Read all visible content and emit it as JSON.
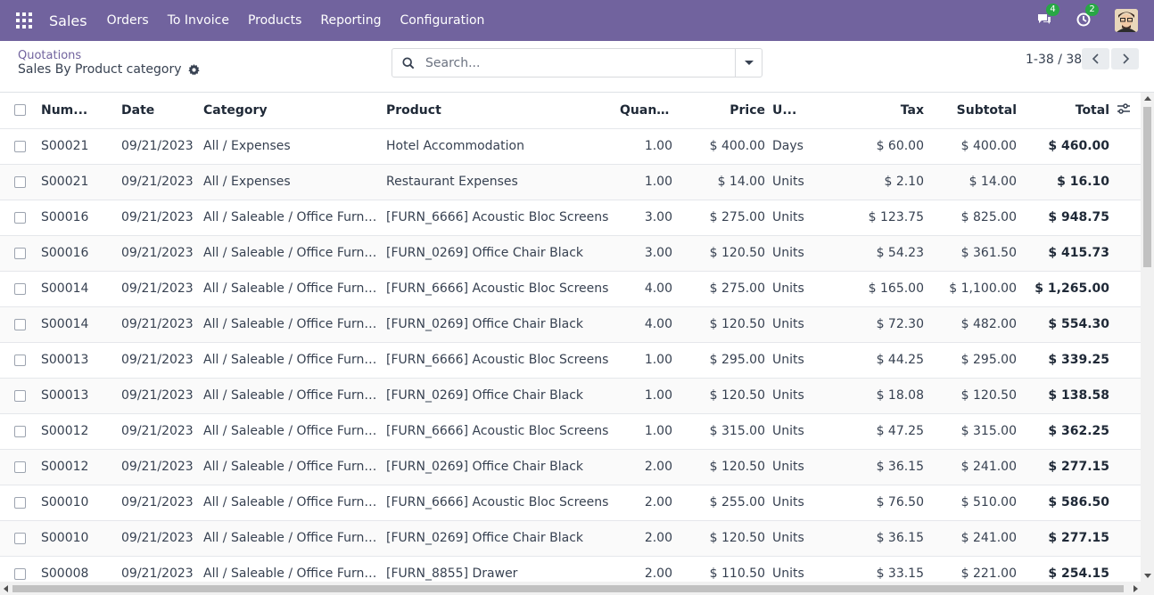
{
  "navbar": {
    "app_name": "Sales",
    "menu": [
      "Orders",
      "To Invoice",
      "Products",
      "Reporting",
      "Configuration"
    ],
    "messages_badge": "4",
    "activities_badge": "2"
  },
  "control_panel": {
    "breadcrumb": "Quotations",
    "title": "Sales By Product category",
    "search_placeholder": "Search...",
    "pager": "1-38 / 38"
  },
  "table": {
    "columns": [
      "Num...",
      "Date",
      "Category",
      "Product",
      "Quant...",
      "Price",
      "U...",
      "Tax",
      "Subtotal",
      "Total"
    ],
    "rows": [
      [
        "S00021",
        "09/21/2023",
        "All / Expenses",
        "Hotel Accommodation",
        "1.00",
        "$ 400.00",
        "Days",
        "$ 60.00",
        "$ 400.00",
        "$ 460.00"
      ],
      [
        "S00021",
        "09/21/2023",
        "All / Expenses",
        "Restaurant Expenses",
        "1.00",
        "$ 14.00",
        "Units",
        "$ 2.10",
        "$ 14.00",
        "$ 16.10"
      ],
      [
        "S00016",
        "09/21/2023",
        "All / Saleable / Office Furniture",
        "[FURN_6666] Acoustic Bloc Screens",
        "3.00",
        "$ 275.00",
        "Units",
        "$ 123.75",
        "$ 825.00",
        "$ 948.75"
      ],
      [
        "S00016",
        "09/21/2023",
        "All / Saleable / Office Furniture",
        "[FURN_0269] Office Chair Black",
        "3.00",
        "$ 120.50",
        "Units",
        "$ 54.23",
        "$ 361.50",
        "$ 415.73"
      ],
      [
        "S00014",
        "09/21/2023",
        "All / Saleable / Office Furniture",
        "[FURN_6666] Acoustic Bloc Screens",
        "4.00",
        "$ 275.00",
        "Units",
        "$ 165.00",
        "$ 1,100.00",
        "$ 1,265.00"
      ],
      [
        "S00014",
        "09/21/2023",
        "All / Saleable / Office Furniture",
        "[FURN_0269] Office Chair Black",
        "4.00",
        "$ 120.50",
        "Units",
        "$ 72.30",
        "$ 482.00",
        "$ 554.30"
      ],
      [
        "S00013",
        "09/21/2023",
        "All / Saleable / Office Furniture",
        "[FURN_6666] Acoustic Bloc Screens",
        "1.00",
        "$ 295.00",
        "Units",
        "$ 44.25",
        "$ 295.00",
        "$ 339.25"
      ],
      [
        "S00013",
        "09/21/2023",
        "All / Saleable / Office Furniture",
        "[FURN_0269] Office Chair Black",
        "1.00",
        "$ 120.50",
        "Units",
        "$ 18.08",
        "$ 120.50",
        "$ 138.58"
      ],
      [
        "S00012",
        "09/21/2023",
        "All / Saleable / Office Furniture",
        "[FURN_6666] Acoustic Bloc Screens",
        "1.00",
        "$ 315.00",
        "Units",
        "$ 47.25",
        "$ 315.00",
        "$ 362.25"
      ],
      [
        "S00012",
        "09/21/2023",
        "All / Saleable / Office Furniture",
        "[FURN_0269] Office Chair Black",
        "2.00",
        "$ 120.50",
        "Units",
        "$ 36.15",
        "$ 241.00",
        "$ 277.15"
      ],
      [
        "S00010",
        "09/21/2023",
        "All / Saleable / Office Furniture",
        "[FURN_6666] Acoustic Bloc Screens",
        "2.00",
        "$ 255.00",
        "Units",
        "$ 76.50",
        "$ 510.00",
        "$ 586.50"
      ],
      [
        "S00010",
        "09/21/2023",
        "All / Saleable / Office Furniture",
        "[FURN_0269] Office Chair Black",
        "2.00",
        "$ 120.50",
        "Units",
        "$ 36.15",
        "$ 241.00",
        "$ 277.15"
      ],
      [
        "S00008",
        "09/21/2023",
        "All / Saleable / Office Furniture",
        "[FURN_8855] Drawer",
        "2.00",
        "$ 110.50",
        "Units",
        "$ 33.15",
        "$ 221.00",
        "$ 254.15"
      ]
    ]
  },
  "colors": {
    "navbar": "#71639e",
    "badge": "#28a745"
  },
  "icons": [
    "apps-icon",
    "chat-icon",
    "clock-icon",
    "search-icon",
    "gear-icon",
    "optional-columns-icon",
    "chevron-left-icon",
    "chevron-right-icon"
  ]
}
